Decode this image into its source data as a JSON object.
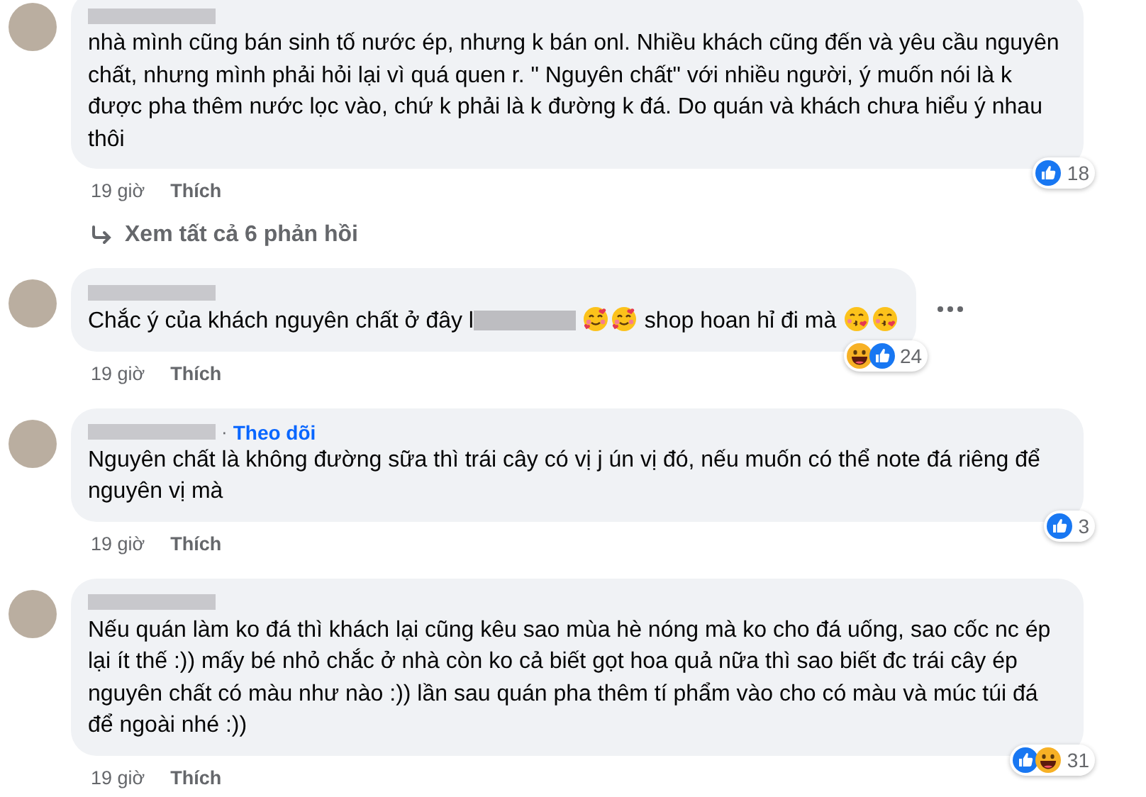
{
  "comments": [
    {
      "author_blurred": true,
      "parts": [
        {
          "kind": "text",
          "text": "nhà mình cũng bán sinh tố nước ép, nhưng k bán onl. Nhiều khách cũng đến và yêu cầu nguyên chất, nhưng mình phải hỏi lại vì quá quen r. \" Nguyên chất\" với nhiều người, ý muốn nói là k được pha thêm nước lọc vào, chứ k phải là k đường k đá. Do quán và khách chưa hiểu ý nhau thôi"
        }
      ],
      "time": "19 giờ",
      "like": "Thích",
      "reactions": [
        {
          "kind": "like"
        }
      ],
      "reaction_count": "18",
      "replies_link": "Xem tất cả 6 phản hồi",
      "menu": false
    },
    {
      "author_blurred": true,
      "parts": [
        {
          "kind": "text",
          "text": "Chắc ý của khách nguyên chất ở đây l"
        },
        {
          "kind": "redacted"
        },
        {
          "kind": "hearts_emoji"
        },
        {
          "kind": "hearts_emoji"
        },
        {
          "kind": "text",
          "text": " shop hoan hỉ đi mà "
        },
        {
          "kind": "kiss_emoji"
        },
        {
          "kind": "kiss_emoji"
        }
      ],
      "time": "19 giờ",
      "like": "Thích",
      "reactions": [
        {
          "kind": "haha"
        },
        {
          "kind": "like"
        }
      ],
      "reaction_count": "24",
      "menu": true
    },
    {
      "author_blurred": true,
      "separator": "·",
      "follow_link": "Theo dõi",
      "parts": [
        {
          "kind": "text",
          "text": "Nguyên chất là không đường sữa thì trái cây có vị j ún vị đó, nếu muốn có thể note đá riêng để nguyên vị mà"
        }
      ],
      "time": "19 giờ",
      "like": "Thích",
      "reactions": [
        {
          "kind": "like"
        }
      ],
      "reaction_count": "3",
      "menu": false
    },
    {
      "author_blurred": true,
      "parts": [
        {
          "kind": "text",
          "text": "Nếu quán làm ko đá thì khách lại cũng kêu sao mùa hè nóng mà ko cho đá uống, sao cốc nc ép lại ít thế :)) mấy bé nhỏ chắc ở nhà còn ko cả biết gọt hoa quả nữa thì sao biết đc trái cây ép nguyên chất có màu như nào :)) lần sau quán pha thêm tí phẩm vào cho có màu và múc túi đá để ngoài nhé :))"
        }
      ],
      "time": "19 giờ",
      "like": "Thích",
      "reactions": [
        {
          "kind": "like"
        },
        {
          "kind": "haha"
        }
      ],
      "reaction_count": "31",
      "menu": false
    }
  ]
}
